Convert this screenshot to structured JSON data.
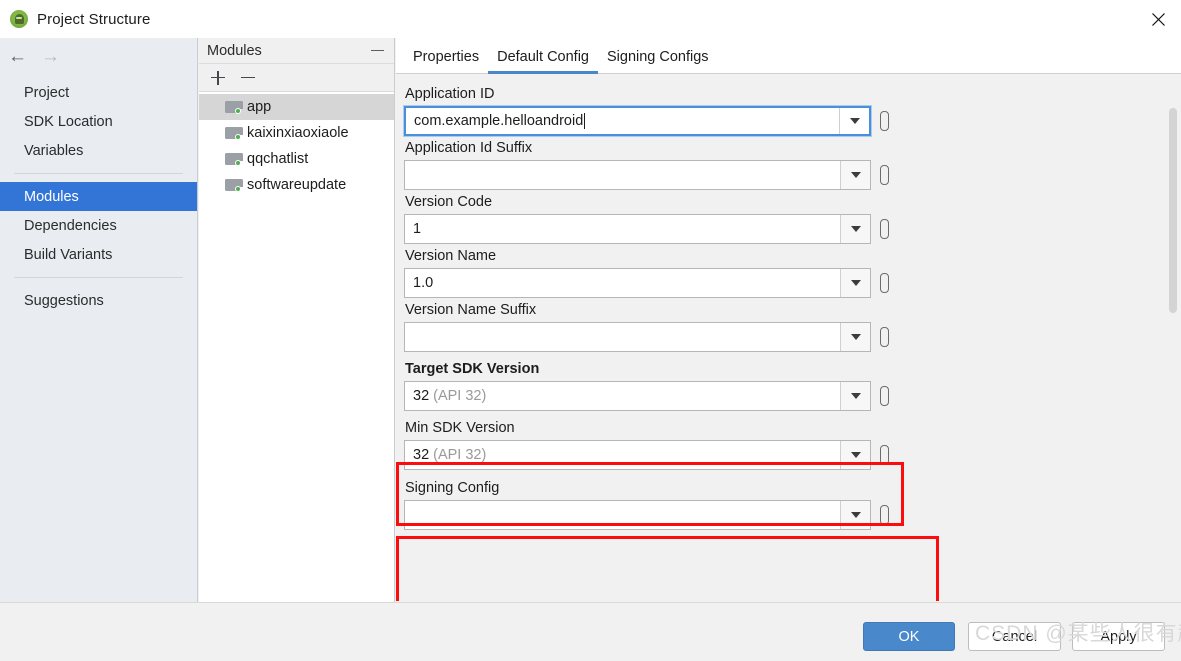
{
  "window": {
    "title": "Project Structure",
    "app_icon": "android-studio-icon",
    "close_icon": "close-icon"
  },
  "nav": {
    "back_icon": "arrow-left-icon",
    "forward_icon": "arrow-right-icon",
    "groups": [
      {
        "items": [
          {
            "label": "Project",
            "selected": false
          },
          {
            "label": "SDK Location",
            "selected": false
          },
          {
            "label": "Variables",
            "selected": false
          }
        ]
      },
      {
        "items": [
          {
            "label": "Modules",
            "selected": true
          },
          {
            "label": "Dependencies",
            "selected": false
          },
          {
            "label": "Build Variants",
            "selected": false
          }
        ]
      },
      {
        "items": [
          {
            "label": "Suggestions",
            "selected": false
          }
        ]
      }
    ]
  },
  "modules_panel": {
    "title": "Modules",
    "collapse_icon": "minus-icon",
    "add_icon": "plus-icon",
    "remove_icon": "minus-icon",
    "items": [
      {
        "label": "app",
        "selected": true
      },
      {
        "label": "kaixinxiaoxiaole",
        "selected": false
      },
      {
        "label": "qqchatlist",
        "selected": false
      },
      {
        "label": "softwareupdate",
        "selected": false
      }
    ]
  },
  "tabs": [
    {
      "label": "Properties",
      "active": false
    },
    {
      "label": "Default Config",
      "active": true
    },
    {
      "label": "Signing Configs",
      "active": false
    }
  ],
  "fields": [
    {
      "label": "Application ID",
      "value": "com.example.helloandroid",
      "suffix": "",
      "bold": false,
      "focused": true,
      "caret": true
    },
    {
      "label": "Application Id Suffix",
      "value": "",
      "suffix": "",
      "bold": false,
      "focused": false,
      "caret": false
    },
    {
      "label": "Version Code",
      "value": "1",
      "suffix": "",
      "bold": false,
      "focused": false,
      "caret": false
    },
    {
      "label": "Version Name",
      "value": "1.0",
      "suffix": "",
      "bold": false,
      "focused": false,
      "caret": false
    },
    {
      "label": "Version Name Suffix",
      "value": "",
      "suffix": "",
      "bold": false,
      "focused": false,
      "caret": false
    },
    {
      "label": "Target SDK Version",
      "value": "32",
      "suffix": "(API 32)",
      "bold": true,
      "focused": false,
      "caret": false
    },
    {
      "label": "Min SDK Version",
      "value": "32",
      "suffix": "(API 32)",
      "bold": false,
      "focused": false,
      "caret": false
    },
    {
      "label": "Signing Config",
      "value": "",
      "suffix": "",
      "bold": false,
      "focused": false,
      "caret": false
    }
  ],
  "annotations": {
    "highlight_color": "#fc0d0d",
    "boxes": [
      "Target SDK Version",
      "Min SDK Version"
    ]
  },
  "footer": {
    "ok_label": "OK",
    "cancel_label": "Cancel",
    "apply_label": "Apply",
    "ok_color": "#4a88cc"
  },
  "watermark": "CSDN @某些人很有趣"
}
